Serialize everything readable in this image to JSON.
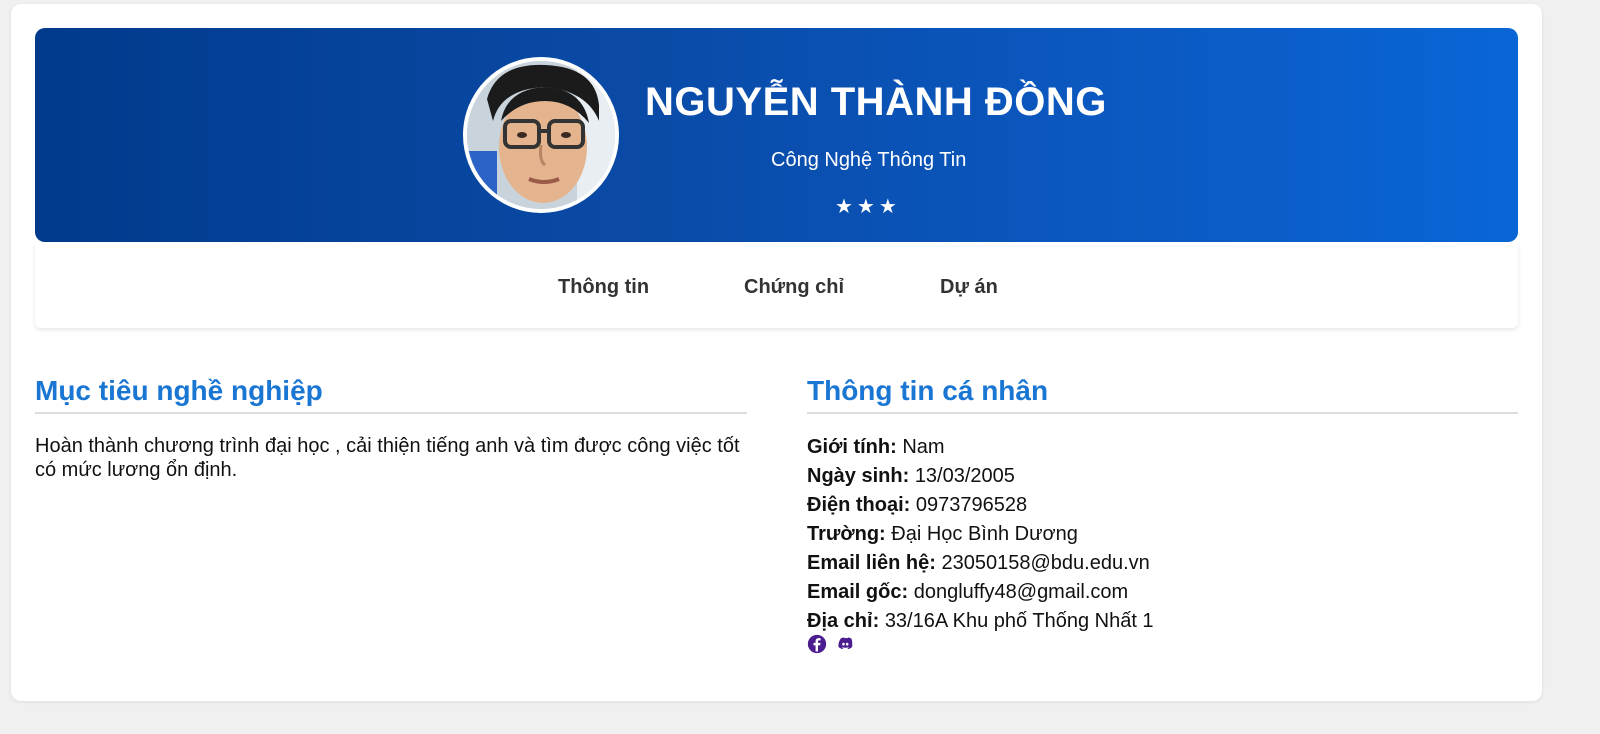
{
  "header": {
    "name": "NGUYỄN THÀNH ĐỒNG",
    "major": "Công Nghệ Thông Tin",
    "stars": "★★★"
  },
  "tabs": [
    {
      "label": "Thông tin"
    },
    {
      "label": "Chứng chỉ"
    },
    {
      "label": "Dự án"
    }
  ],
  "goal": {
    "title": "Mục tiêu nghề nghiệp",
    "text": "Hoàn thành chương trình đại học , cải thiện tiếng anh và tìm được công việc tốt có mức lương ổn định."
  },
  "personal": {
    "title": "Thông tin cá nhân",
    "rows": [
      {
        "label": "Giới tính:",
        "value": "Nam"
      },
      {
        "label": "Ngày sinh:",
        "value": "13/03/2005"
      },
      {
        "label": "Điện thoại:",
        "value": "0973796528"
      },
      {
        "label": "Trường:",
        "value": "Đại Học Bình Dương"
      },
      {
        "label": "Email liên hệ:",
        "value": "23050158@bdu.edu.vn"
      },
      {
        "label": "Email gốc:",
        "value": "dongluffy48@gmail.com"
      },
      {
        "label": "Địa chỉ:",
        "value": "33/16A Khu phố Thống Nhất 1"
      }
    ]
  },
  "socials": [
    {
      "icon": "facebook-icon"
    },
    {
      "icon": "discord-icon"
    }
  ],
  "colors": {
    "banner_start": "#003a8c",
    "banner_end": "#0a66d6",
    "section_title": "#1976d2",
    "social_icon": "#4b1d8f"
  }
}
